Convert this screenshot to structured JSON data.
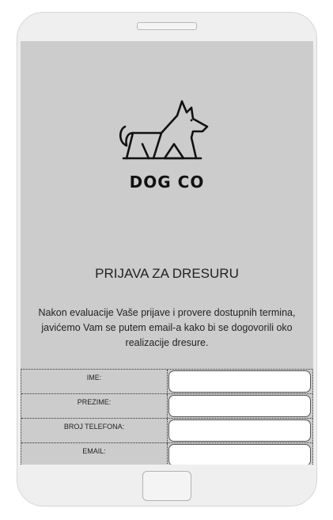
{
  "brand": {
    "name": "DOG CO",
    "logo_icon": "dog-icon"
  },
  "form": {
    "title": "PRIJAVA ZA DRESURU",
    "description": "Nakon evaluacije Vaše prijave i provere dostupnih termina, javićemo Vam se putem email-a kako bi se dogovorili oko realizacije dresure.",
    "fields": [
      {
        "label": "IME:",
        "value": ""
      },
      {
        "label": "PREZIME:",
        "value": ""
      },
      {
        "label": "BROJ TELEFONA:",
        "value": ""
      },
      {
        "label": "EMAIL:",
        "value": ""
      }
    ]
  },
  "colors": {
    "screen": "#cccccc",
    "frame": "#efefef",
    "text": "#222222"
  }
}
